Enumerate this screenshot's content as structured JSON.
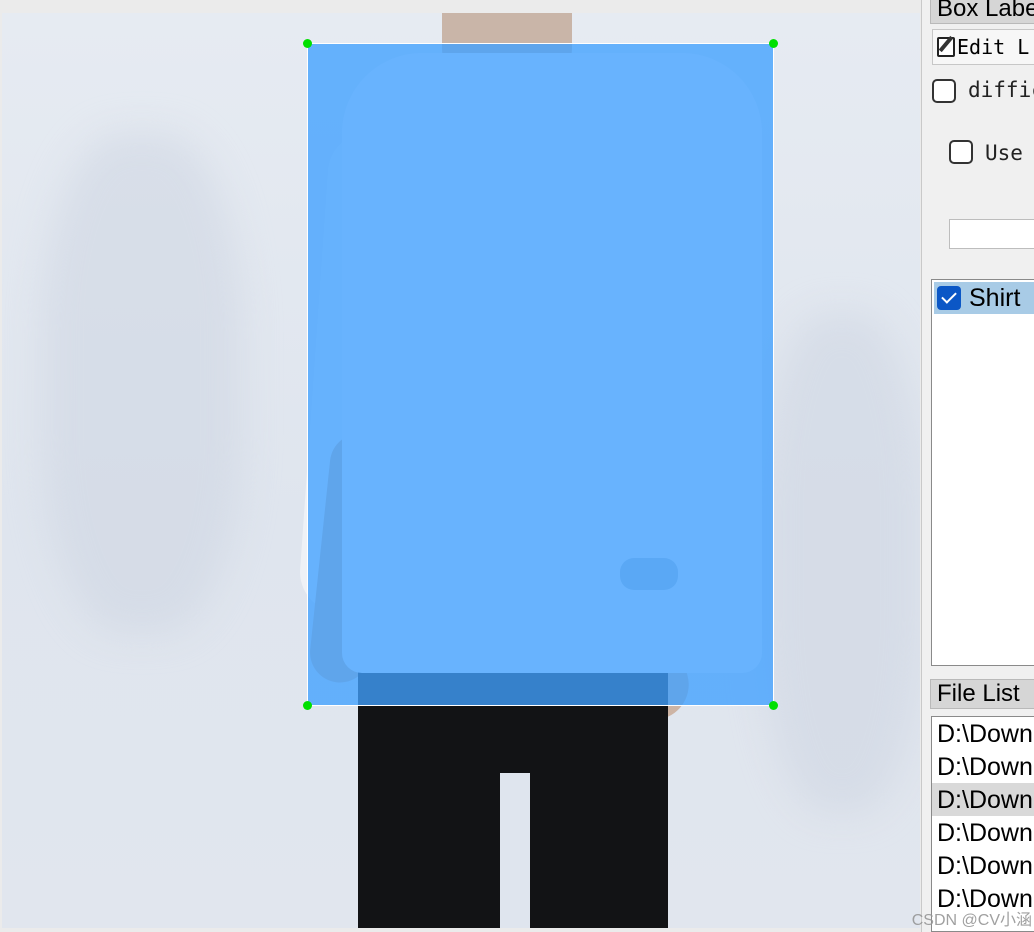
{
  "dock": {
    "box_labels_title": "Box Labe",
    "edit_label_button": "Edit L",
    "difficult_label": "diffic",
    "use_default_label": "Use",
    "default_label_value": ""
  },
  "labels": [
    {
      "name": "Shirt",
      "checked": true
    }
  ],
  "file_list": {
    "title": "File List",
    "files": [
      "D:\\Down",
      "D:\\Down",
      "D:\\Down",
      "D:\\Down",
      "D:\\Down",
      "D:\\Down"
    ],
    "selected_index": 2
  },
  "annotation": {
    "label": "Shirt",
    "fill_color": "#40a0ff",
    "handle_color": "#00e000"
  },
  "watermark": "CSDN @CV小涵"
}
